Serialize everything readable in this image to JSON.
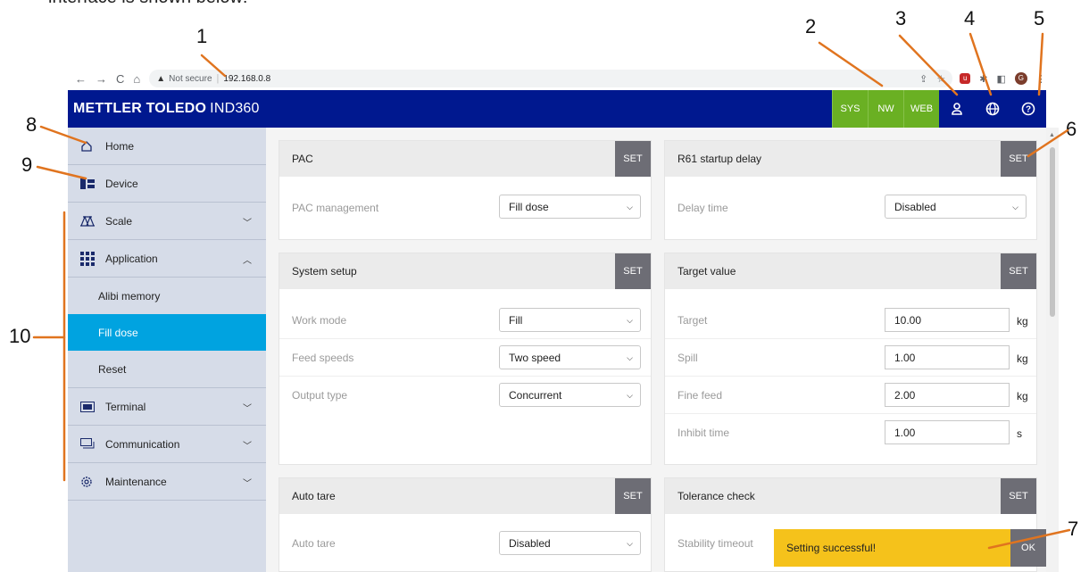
{
  "doc": {
    "heading": "interface is shown below:",
    "callouts": [
      "1",
      "2",
      "3",
      "4",
      "5",
      "6",
      "7",
      "8",
      "9",
      "10"
    ]
  },
  "browser": {
    "security_label": "Not secure",
    "url": "192.168.0.8",
    "profile_initial": "G"
  },
  "app": {
    "brand_bold": "METTLER TOLEDO",
    "brand_model": "IND360",
    "mode_buttons": [
      "SYS",
      "NW",
      "WEB"
    ],
    "accent": "#00188f",
    "green": "#6ab023"
  },
  "sidebar": {
    "items": [
      {
        "label": "Home",
        "icon": "home-icon"
      },
      {
        "label": "Device",
        "icon": "device-icon"
      },
      {
        "label": "Scale",
        "icon": "scale-icon"
      },
      {
        "label": "Application",
        "icon": "grid-icon"
      },
      {
        "label": "Terminal",
        "icon": "terminal-icon"
      },
      {
        "label": "Communication",
        "icon": "communication-icon"
      },
      {
        "label": "Maintenance",
        "icon": "gear-icon"
      }
    ],
    "application_subitems": [
      "Alibi memory",
      "Fill dose",
      "Reset"
    ],
    "active_subitem": "Fill dose"
  },
  "cards": {
    "set_label": "SET",
    "pac": {
      "title": "PAC",
      "rows": [
        {
          "label": "PAC management",
          "value": "Fill dose"
        }
      ]
    },
    "r61": {
      "title": "R61 startup delay",
      "rows": [
        {
          "label": "Delay time",
          "value": "Disabled"
        }
      ]
    },
    "system_setup": {
      "title": "System setup",
      "rows": [
        {
          "label": "Work mode",
          "value": "Fill"
        },
        {
          "label": "Feed speeds",
          "value": "Two speed"
        },
        {
          "label": "Output type",
          "value": "Concurrent"
        }
      ]
    },
    "target_value": {
      "title": "Target value",
      "rows": [
        {
          "label": "Target",
          "value": "10.00",
          "unit": "kg"
        },
        {
          "label": "Spill",
          "value": "1.00",
          "unit": "kg"
        },
        {
          "label": "Fine feed",
          "value": "2.00",
          "unit": "kg"
        },
        {
          "label": "Inhibit time",
          "value": "1.00",
          "unit": "s"
        }
      ]
    },
    "auto_tare": {
      "title": "Auto tare",
      "rows": [
        {
          "label": "Auto tare",
          "value": "Disabled"
        }
      ]
    },
    "tolerance_check": {
      "title": "Tolerance check",
      "rows": [
        {
          "label": "Stability timeout"
        }
      ]
    }
  },
  "toast": {
    "message": "Setting successful!",
    "ok_label": "OK",
    "color": "#f5c21b"
  }
}
